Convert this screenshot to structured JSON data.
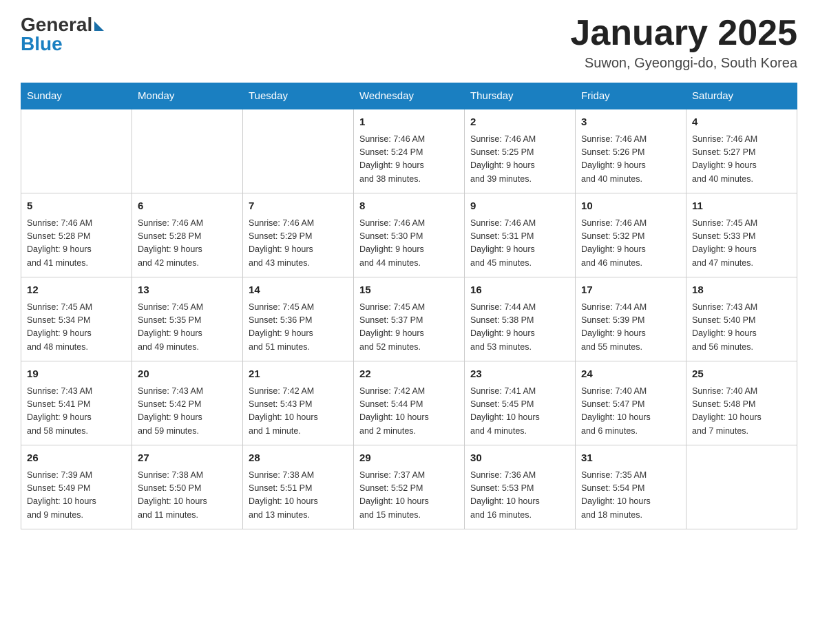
{
  "header": {
    "logo_general": "General",
    "logo_blue": "Blue",
    "month_title": "January 2025",
    "location": "Suwon, Gyeonggi-do, South Korea"
  },
  "weekdays": [
    "Sunday",
    "Monday",
    "Tuesday",
    "Wednesday",
    "Thursday",
    "Friday",
    "Saturday"
  ],
  "weeks": [
    [
      {
        "day": "",
        "info": ""
      },
      {
        "day": "",
        "info": ""
      },
      {
        "day": "",
        "info": ""
      },
      {
        "day": "1",
        "info": "Sunrise: 7:46 AM\nSunset: 5:24 PM\nDaylight: 9 hours\nand 38 minutes."
      },
      {
        "day": "2",
        "info": "Sunrise: 7:46 AM\nSunset: 5:25 PM\nDaylight: 9 hours\nand 39 minutes."
      },
      {
        "day": "3",
        "info": "Sunrise: 7:46 AM\nSunset: 5:26 PM\nDaylight: 9 hours\nand 40 minutes."
      },
      {
        "day": "4",
        "info": "Sunrise: 7:46 AM\nSunset: 5:27 PM\nDaylight: 9 hours\nand 40 minutes."
      }
    ],
    [
      {
        "day": "5",
        "info": "Sunrise: 7:46 AM\nSunset: 5:28 PM\nDaylight: 9 hours\nand 41 minutes."
      },
      {
        "day": "6",
        "info": "Sunrise: 7:46 AM\nSunset: 5:28 PM\nDaylight: 9 hours\nand 42 minutes."
      },
      {
        "day": "7",
        "info": "Sunrise: 7:46 AM\nSunset: 5:29 PM\nDaylight: 9 hours\nand 43 minutes."
      },
      {
        "day": "8",
        "info": "Sunrise: 7:46 AM\nSunset: 5:30 PM\nDaylight: 9 hours\nand 44 minutes."
      },
      {
        "day": "9",
        "info": "Sunrise: 7:46 AM\nSunset: 5:31 PM\nDaylight: 9 hours\nand 45 minutes."
      },
      {
        "day": "10",
        "info": "Sunrise: 7:46 AM\nSunset: 5:32 PM\nDaylight: 9 hours\nand 46 minutes."
      },
      {
        "day": "11",
        "info": "Sunrise: 7:45 AM\nSunset: 5:33 PM\nDaylight: 9 hours\nand 47 minutes."
      }
    ],
    [
      {
        "day": "12",
        "info": "Sunrise: 7:45 AM\nSunset: 5:34 PM\nDaylight: 9 hours\nand 48 minutes."
      },
      {
        "day": "13",
        "info": "Sunrise: 7:45 AM\nSunset: 5:35 PM\nDaylight: 9 hours\nand 49 minutes."
      },
      {
        "day": "14",
        "info": "Sunrise: 7:45 AM\nSunset: 5:36 PM\nDaylight: 9 hours\nand 51 minutes."
      },
      {
        "day": "15",
        "info": "Sunrise: 7:45 AM\nSunset: 5:37 PM\nDaylight: 9 hours\nand 52 minutes."
      },
      {
        "day": "16",
        "info": "Sunrise: 7:44 AM\nSunset: 5:38 PM\nDaylight: 9 hours\nand 53 minutes."
      },
      {
        "day": "17",
        "info": "Sunrise: 7:44 AM\nSunset: 5:39 PM\nDaylight: 9 hours\nand 55 minutes."
      },
      {
        "day": "18",
        "info": "Sunrise: 7:43 AM\nSunset: 5:40 PM\nDaylight: 9 hours\nand 56 minutes."
      }
    ],
    [
      {
        "day": "19",
        "info": "Sunrise: 7:43 AM\nSunset: 5:41 PM\nDaylight: 9 hours\nand 58 minutes."
      },
      {
        "day": "20",
        "info": "Sunrise: 7:43 AM\nSunset: 5:42 PM\nDaylight: 9 hours\nand 59 minutes."
      },
      {
        "day": "21",
        "info": "Sunrise: 7:42 AM\nSunset: 5:43 PM\nDaylight: 10 hours\nand 1 minute."
      },
      {
        "day": "22",
        "info": "Sunrise: 7:42 AM\nSunset: 5:44 PM\nDaylight: 10 hours\nand 2 minutes."
      },
      {
        "day": "23",
        "info": "Sunrise: 7:41 AM\nSunset: 5:45 PM\nDaylight: 10 hours\nand 4 minutes."
      },
      {
        "day": "24",
        "info": "Sunrise: 7:40 AM\nSunset: 5:47 PM\nDaylight: 10 hours\nand 6 minutes."
      },
      {
        "day": "25",
        "info": "Sunrise: 7:40 AM\nSunset: 5:48 PM\nDaylight: 10 hours\nand 7 minutes."
      }
    ],
    [
      {
        "day": "26",
        "info": "Sunrise: 7:39 AM\nSunset: 5:49 PM\nDaylight: 10 hours\nand 9 minutes."
      },
      {
        "day": "27",
        "info": "Sunrise: 7:38 AM\nSunset: 5:50 PM\nDaylight: 10 hours\nand 11 minutes."
      },
      {
        "day": "28",
        "info": "Sunrise: 7:38 AM\nSunset: 5:51 PM\nDaylight: 10 hours\nand 13 minutes."
      },
      {
        "day": "29",
        "info": "Sunrise: 7:37 AM\nSunset: 5:52 PM\nDaylight: 10 hours\nand 15 minutes."
      },
      {
        "day": "30",
        "info": "Sunrise: 7:36 AM\nSunset: 5:53 PM\nDaylight: 10 hours\nand 16 minutes."
      },
      {
        "day": "31",
        "info": "Sunrise: 7:35 AM\nSunset: 5:54 PM\nDaylight: 10 hours\nand 18 minutes."
      },
      {
        "day": "",
        "info": ""
      }
    ]
  ]
}
